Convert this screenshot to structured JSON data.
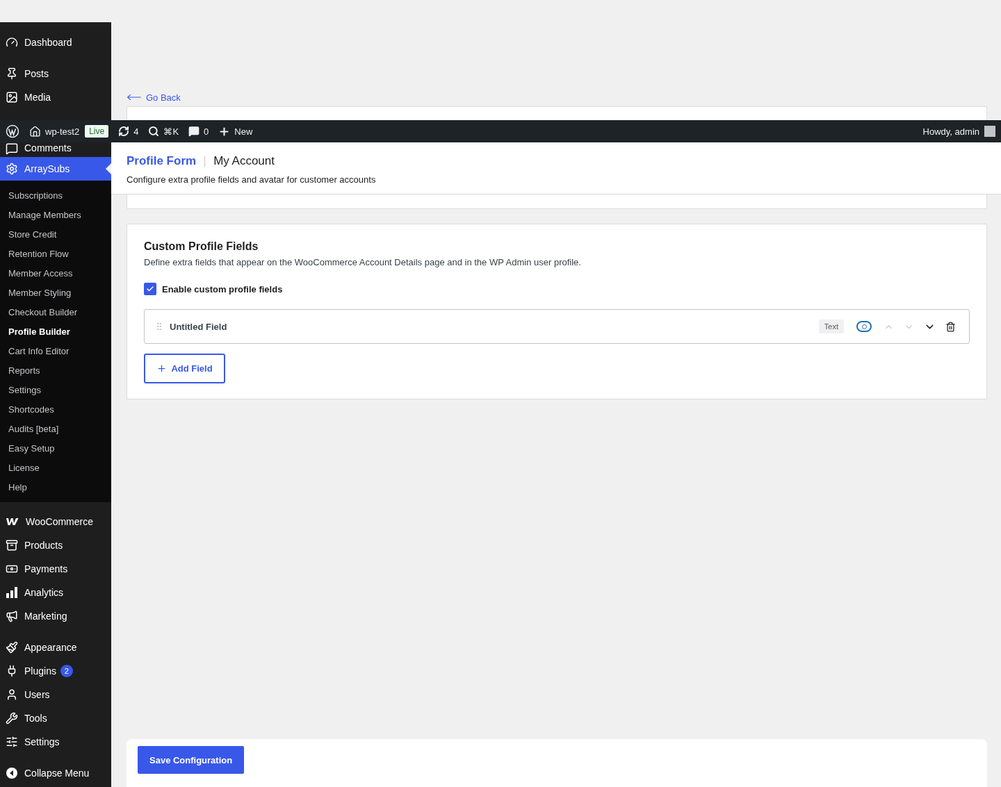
{
  "admin_bar": {
    "site": "wp-test2",
    "env_badge": "Live",
    "updates": "4",
    "search_shortcut": "⌘K",
    "comments": "0",
    "new_label": "New",
    "greeting": "Howdy, admin"
  },
  "sidebar": {
    "groups": [
      [
        {
          "label": "Dashboard",
          "selected": false
        }
      ],
      [
        {
          "label": "Posts",
          "selected": false
        },
        {
          "label": "Media",
          "selected": false
        },
        {
          "label": "Comments",
          "selected": false
        },
        {
          "label": "ArraySubs",
          "selected": true,
          "submenu": [
            {
              "label": "Subscriptions",
              "selected": false
            },
            {
              "label": "Manage Members",
              "selected": false
            },
            {
              "label": "Store Credit",
              "selected": false
            },
            {
              "label": "Retention Flow",
              "selected": false
            },
            {
              "label": "Member Access",
              "selected": false
            },
            {
              "label": "Member Styling",
              "selected": false
            },
            {
              "label": "Checkout Builder",
              "selected": false
            },
            {
              "label": "Profile Builder",
              "selected": true
            },
            {
              "label": "Cart Info Editor",
              "selected": false
            },
            {
              "label": "Reports",
              "selected": false
            },
            {
              "label": "Settings",
              "selected": false
            },
            {
              "label": "Shortcodes",
              "selected": false
            },
            {
              "label": "Audits [beta]",
              "selected": false
            },
            {
              "label": "Easy Setup",
              "selected": false
            },
            {
              "label": "License",
              "selected": false
            },
            {
              "label": "Help",
              "selected": false
            }
          ]
        }
      ],
      [
        {
          "label": "WooCommerce",
          "selected": false
        },
        {
          "label": "Products",
          "selected": false
        },
        {
          "label": "Payments",
          "selected": false
        },
        {
          "label": "Analytics",
          "selected": false
        },
        {
          "label": "Marketing",
          "selected": false
        }
      ],
      [
        {
          "label": "Appearance",
          "selected": false
        },
        {
          "label": "Plugins",
          "selected": false,
          "badge": "2"
        },
        {
          "label": "Users",
          "selected": false
        },
        {
          "label": "Tools",
          "selected": false
        },
        {
          "label": "Settings",
          "selected": false
        }
      ]
    ],
    "collapse": "Collapse Menu"
  },
  "back_link": "Go Back",
  "header": {
    "title": "Profile Form",
    "subtitle": "My Account",
    "description": "Configure extra profile fields and avatar for customer accounts"
  },
  "section": {
    "title": "Custom Profile Fields",
    "description": "Define extra fields that appear on the WooCommerce Account Details page and in the WP Admin user profile.",
    "enable": {
      "label": "Enable custom profile fields",
      "checked": true
    },
    "fields": [
      {
        "label": "Untitled Field",
        "type": "Text",
        "visible": true,
        "can_move_up": false,
        "can_move_down": false
      }
    ],
    "add_button": "Add Field"
  },
  "save_button": "Save Configuration"
}
